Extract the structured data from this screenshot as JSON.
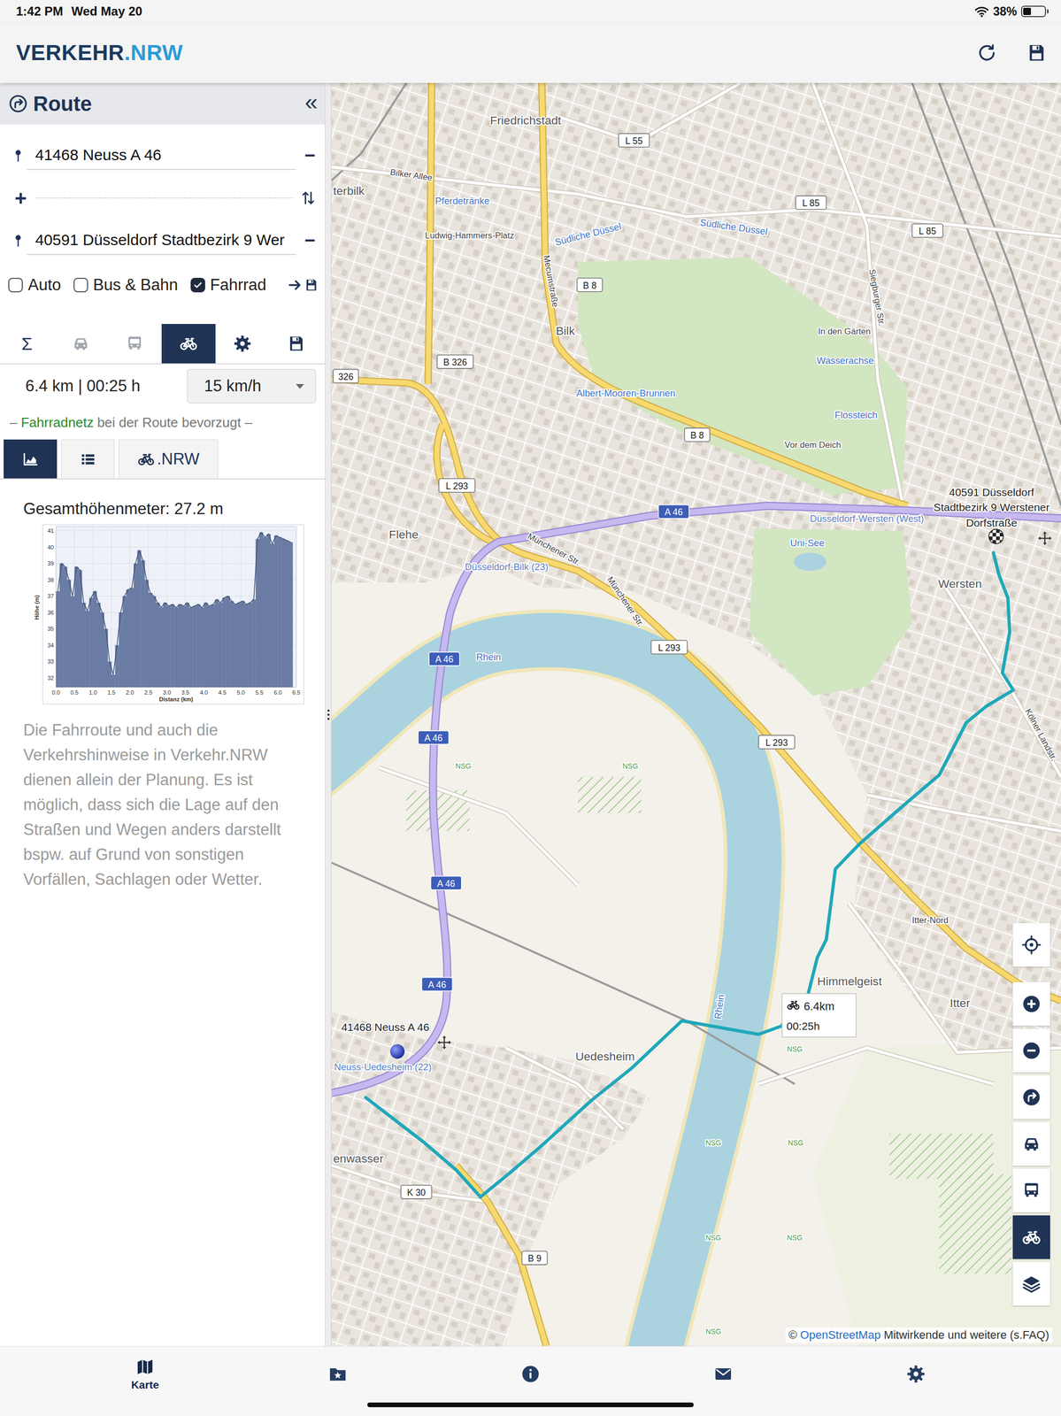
{
  "status_bar": {
    "time": "1:42 PM",
    "date": "Wed May 20",
    "battery": "38%",
    "battery_level": 0.38
  },
  "header": {
    "logo_main": "VERKEHR",
    "logo_accent": ".NRW"
  },
  "panel": {
    "title": "Route",
    "collapse": "«",
    "stops": [
      {
        "value": "41468 Neuss A 46",
        "remove": "−"
      },
      {
        "value": "40591 Düsseldorf Stadtbezirk 9 Wer",
        "remove": "−"
      }
    ],
    "add": "+",
    "modes": [
      {
        "label": "Auto",
        "checked": false
      },
      {
        "label": "Bus & Bahn",
        "checked": false
      },
      {
        "label": "Fahrrad",
        "checked": true
      }
    ],
    "tabs": [
      {
        "kind": "sum",
        "label": "Σ",
        "selected": false,
        "disabled": false
      },
      {
        "kind": "car",
        "selected": false,
        "disabled": true
      },
      {
        "kind": "bus",
        "selected": false,
        "disabled": true
      },
      {
        "kind": "bike",
        "selected": true,
        "disabled": false
      },
      {
        "kind": "settings",
        "selected": false,
        "disabled": false
      },
      {
        "kind": "save",
        "selected": false,
        "disabled": false
      }
    ],
    "summary": "6.4 km | 00:25 h",
    "speed": "15 km/h",
    "preference": {
      "before": "–",
      "link": "Fahrradnetz",
      "after": "bei der Route bevorzugt –"
    },
    "views": [
      {
        "kind": "chart",
        "selected": true
      },
      {
        "kind": "list",
        "selected": false
      },
      {
        "kind": "nrw",
        "label": ".NRW",
        "selected": false
      }
    ],
    "elevation_total": "Gesamthöhenmeter: 27.2 m",
    "chart": {
      "y_label": "Höhe (m)",
      "x_label": "Distanz (km)",
      "y_ticks": [
        "32",
        "33",
        "34",
        "35",
        "36",
        "37",
        "38",
        "39",
        "40",
        "41"
      ],
      "x_ticks": [
        "0.0",
        "0.5",
        "1.0",
        "1.5",
        "2.0",
        "2.5",
        "3.0",
        "3.5",
        "4.0",
        "4.5",
        "5.0",
        "5.5",
        "6.0",
        "6.5"
      ],
      "step_km": 0.1,
      "values": [
        37.3,
        39.0,
        38.8,
        38.0,
        37.0,
        38.8,
        38.6,
        36.6,
        36.1,
        36.9,
        37.3,
        36.6,
        36.0,
        35.0,
        33.0,
        32.2,
        34.0,
        36.0,
        37.0,
        37.4,
        37.5,
        39.0,
        39.8,
        39.2,
        38.0,
        37.2,
        37.0,
        36.6,
        36.3,
        36.6,
        36.4,
        36.5,
        36.3,
        36.5,
        36.4,
        36.6,
        36.3,
        36.4,
        36.5,
        36.3,
        36.6,
        36.4,
        36.5,
        36.8,
        36.6,
        36.9,
        37.0,
        36.7,
        36.5,
        36.6,
        36.7,
        36.5,
        36.6,
        36.8,
        40.5,
        40.9,
        40.6,
        40.8,
        40.2,
        40.7,
        40.6,
        40.5,
        40.4,
        40.3
      ]
    },
    "disclaimer": "Die Fahrroute und auch die Verkehrshinweise in Verkehr.NRW dienen allein der Planung. Es ist möglich, dass sich die Lage auf den Straßen und Wegen anders darstellt bspw. auf Grund von sonstigen Vorfällen, Sachlagen oder Wetter."
  },
  "map": {
    "labels": [
      {
        "text": "Friedrichstadt",
        "kind": "place"
      },
      {
        "text": "Bilker Allee",
        "kind": "street"
      },
      {
        "text": "terbilk",
        "kind": "place"
      },
      {
        "text": "Pferdetränke",
        "kind": "water"
      },
      {
        "text": "Ludwig-Hammers-Platz",
        "kind": "street"
      },
      {
        "text": "Südliche Düssel",
        "kind": "water"
      },
      {
        "text": "Südliche Düssel",
        "kind": "water"
      },
      {
        "text": "Mecumstraße",
        "kind": "street"
      },
      {
        "text": "Bilk",
        "kind": "place"
      },
      {
        "text": "Siegburger Str.",
        "kind": "street"
      },
      {
        "text": "In den Gärten",
        "kind": "street"
      },
      {
        "text": "Wasserachse",
        "kind": "water"
      },
      {
        "text": "Albert-Mooren-Brunnen",
        "kind": "water"
      },
      {
        "text": "Flossteich",
        "kind": "water"
      },
      {
        "text": "Vor dem Deich",
        "kind": "street"
      },
      {
        "text": "Flehe",
        "kind": "place"
      },
      {
        "text": "Münchener Str.",
        "kind": "street"
      },
      {
        "text": "Düsseldorf-Bilk (23)",
        "kind": "station"
      },
      {
        "text": "Münchener Str.",
        "kind": "street"
      },
      {
        "text": "Düsseldorf-Wersten (West)",
        "kind": "station"
      },
      {
        "text": "Uni-See",
        "kind": "water"
      },
      {
        "text": "Wersten",
        "kind": "place"
      },
      {
        "text": "Rhein",
        "kind": "water"
      },
      {
        "text": "NSG",
        "kind": "nsg"
      },
      {
        "text": "NSG",
        "kind": "nsg"
      },
      {
        "text": "Kölner Landstr.",
        "kind": "street"
      },
      {
        "text": "Itter-Nord",
        "kind": "street"
      },
      {
        "text": "Himmelgeist",
        "kind": "place"
      },
      {
        "text": "Itter",
        "kind": "place"
      },
      {
        "text": "Uedesheim",
        "kind": "place"
      },
      {
        "text": "Rhein",
        "kind": "water"
      },
      {
        "text": "Neuss-Uedesheim (22)",
        "kind": "station"
      },
      {
        "text": "enwasser",
        "kind": "place"
      },
      {
        "text": "NSG",
        "kind": "nsg"
      },
      {
        "text": "NSG",
        "kind": "nsg"
      },
      {
        "text": "NSG",
        "kind": "nsg"
      },
      {
        "text": "NSG",
        "kind": "nsg"
      },
      {
        "text": "NSG",
        "kind": "nsg"
      },
      {
        "text": "NSG",
        "kind": "nsg"
      }
    ],
    "shields": [
      {
        "text": "L 55",
        "kind": "road"
      },
      {
        "text": "L 85",
        "kind": "road"
      },
      {
        "text": "L 85",
        "kind": "road"
      },
      {
        "text": "B 8",
        "kind": "road"
      },
      {
        "text": "B 326",
        "kind": "road"
      },
      {
        "text": "326",
        "kind": "road"
      },
      {
        "text": "B 8",
        "kind": "road"
      },
      {
        "text": "L 293",
        "kind": "road"
      },
      {
        "text": "A 46",
        "kind": "motorway"
      },
      {
        "text": "L 293",
        "kind": "road"
      },
      {
        "text": "A 46",
        "kind": "motorway"
      },
      {
        "text": "A 46",
        "kind": "motorway"
      },
      {
        "text": "L 293",
        "kind": "road"
      },
      {
        "text": "A 46",
        "kind": "motorway"
      },
      {
        "text": "A 46",
        "kind": "motorway"
      },
      {
        "text": "K 30",
        "kind": "road"
      },
      {
        "text": "B 9",
        "kind": "road"
      }
    ],
    "start": {
      "label": "41468 Neuss A 46"
    },
    "end": {
      "label_lines": [
        "40591 Düsseldorf",
        "Stadtbezirk 9 Werstener",
        "Dorfstraße"
      ]
    },
    "route_badge": {
      "distance": "6.4km",
      "duration": "00:25h"
    },
    "controls": [
      {
        "kind": "locate",
        "selected": false
      },
      {
        "kind": "zoom-in",
        "selected": false
      },
      {
        "kind": "zoom-out",
        "selected": false
      },
      {
        "kind": "route",
        "selected": false
      },
      {
        "kind": "car",
        "selected": false
      },
      {
        "kind": "bus",
        "selected": false
      },
      {
        "kind": "bike",
        "selected": true
      },
      {
        "kind": "layers",
        "selected": false
      }
    ],
    "attribution": {
      "symbol": "©",
      "link": "OpenStreetMap",
      "text": "Mitwirkende und weitere (s.FAQ)"
    }
  },
  "bottom_nav": [
    {
      "kind": "map",
      "label": "Karte",
      "selected": true
    },
    {
      "kind": "favorites",
      "selected": false
    },
    {
      "kind": "info",
      "selected": false
    },
    {
      "kind": "mail",
      "selected": false
    },
    {
      "kind": "settings",
      "selected": false
    }
  ]
}
